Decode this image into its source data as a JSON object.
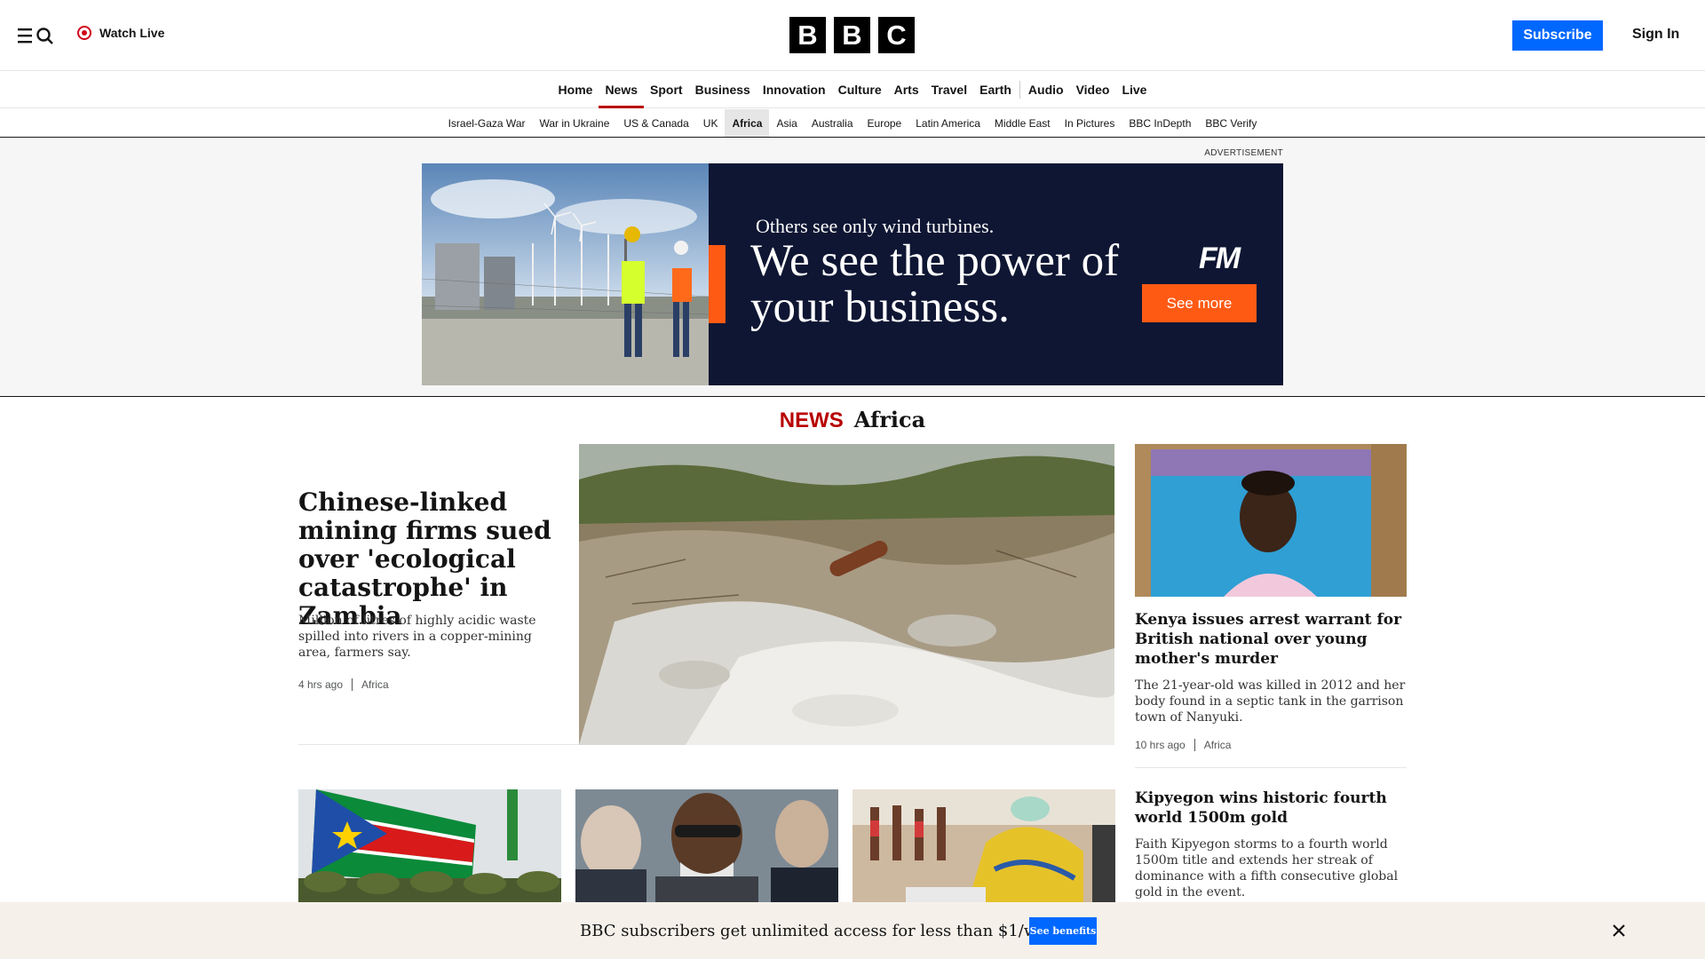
{
  "header": {
    "watch_live": "Watch Live",
    "logo_letters": [
      "B",
      "B",
      "C"
    ],
    "subscribe": "Subscribe",
    "sign_in": "Sign In"
  },
  "primary_nav": [
    "Home",
    "News",
    "Sport",
    "Business",
    "Innovation",
    "Culture",
    "Arts",
    "Travel",
    "Earth",
    "Audio",
    "Video",
    "Live"
  ],
  "primary_nav_active": "News",
  "secondary_nav": [
    "Israel-Gaza War",
    "War in Ukraine",
    "US & Canada",
    "UK",
    "Africa",
    "Asia",
    "Australia",
    "Europe",
    "Latin America",
    "Middle East",
    "In Pictures",
    "BBC InDepth",
    "BBC Verify"
  ],
  "secondary_nav_active": "Africa",
  "advert": {
    "label": "ADVERTISEMENT",
    "line1": "Others see only wind turbines.",
    "line2": "We see the power of your business.",
    "brand": "FM",
    "cta": "See more"
  },
  "section": {
    "brand": "NEWS",
    "region": "Africa"
  },
  "lead_story": {
    "title": "Chinese-linked mining firms sued over 'ecological catastrophe' in Zambia",
    "summary": "Million of litres of highly acidic waste spilled into rivers in a copper-mining area, farmers say.",
    "time": "4 hrs ago",
    "tag": "Africa"
  },
  "side_story": {
    "title": "Kenya issues arrest warrant for British national over young mother's murder",
    "summary": "The 21-year-old was killed in 2012 and her body found in a septic tank in the garrison town of Nanyuki.",
    "time": "10 hrs ago",
    "tag": "Africa"
  },
  "side_story_2": {
    "title": "Kipyegon wins historic fourth world 1500m gold",
    "summary": "Faith Kipyegon storms to a fourth world 1500m title and extends her streak of dominance with a fifth consecutive global gold in the event."
  },
  "subscription_banner": {
    "text": "BBC subscribers get unlimited access for less than $1/week",
    "cta": "See benefits"
  },
  "colors": {
    "brand_red": "#b80000",
    "subscribe_blue": "#0068ff",
    "ad_navy": "#0e1633",
    "ad_orange": "#ff5a14",
    "banner_bg": "#f5f1ea"
  }
}
